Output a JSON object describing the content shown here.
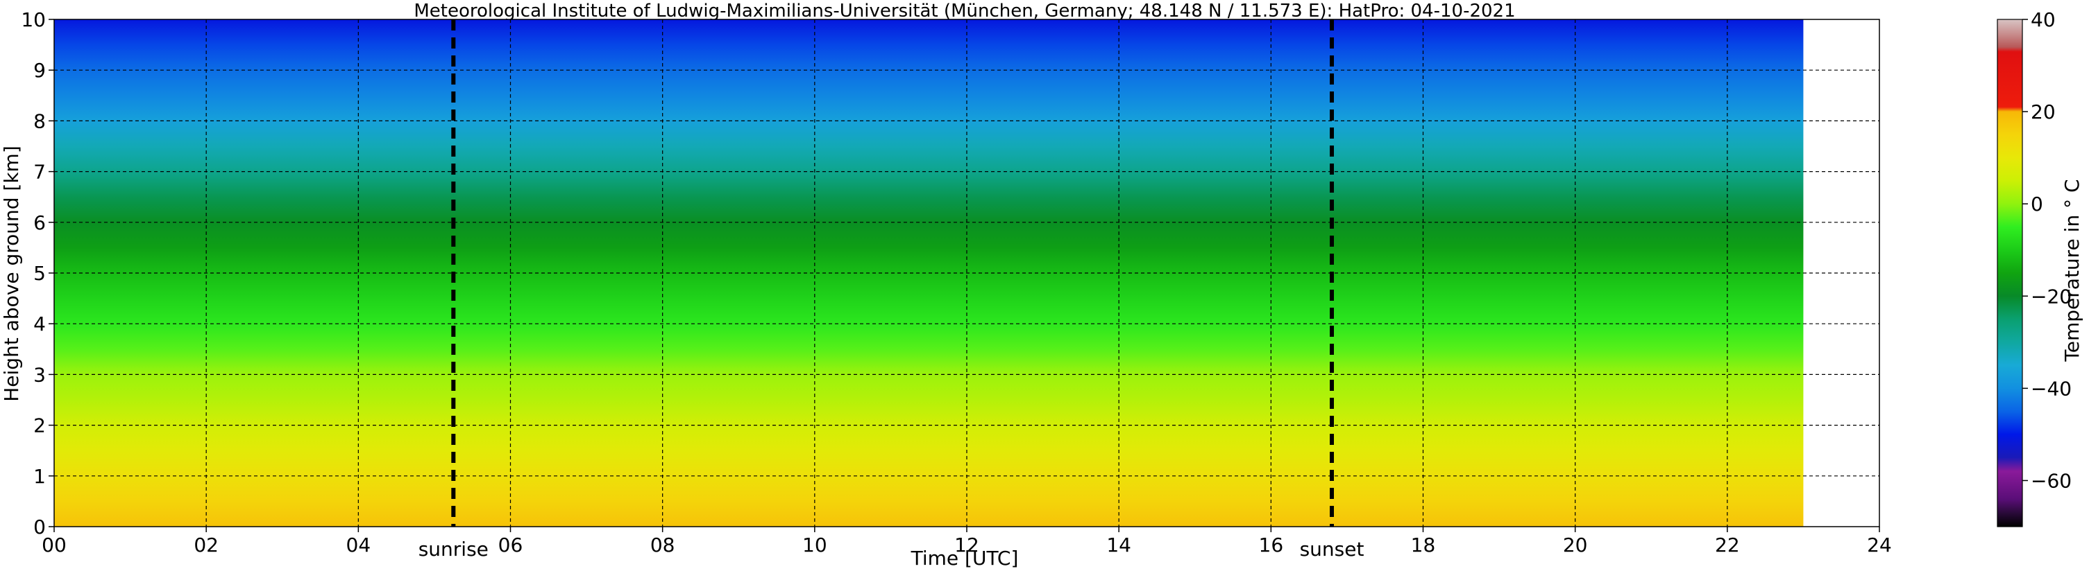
{
  "chart_data": {
    "type": "heatmap",
    "title": "Meteorological Institute of Ludwig-Maximilians-Universität (München, Germany; 48.148 N / 11.573 E):    HatPro: 04-10-2021",
    "xlabel": "Time [UTC]",
    "ylabel": "Height above ground [km]",
    "xlim": [
      0,
      24
    ],
    "ylim": [
      0,
      10
    ],
    "x_ticks": [
      "00",
      "02",
      "04",
      "06",
      "08",
      "10",
      "12",
      "14",
      "16",
      "18",
      "20",
      "22",
      "24"
    ],
    "y_ticks": [
      "0",
      "1",
      "2",
      "3",
      "4",
      "5",
      "6",
      "7",
      "8",
      "9",
      "10"
    ],
    "grid": true,
    "data_end_hour": 23.0,
    "annotations": [
      {
        "label": "sunrise",
        "x": 5.25
      },
      {
        "label": "sunset",
        "x": 16.8
      }
    ],
    "temperature_profile": {
      "height_km": [
        0.0,
        0.5,
        1.0,
        1.5,
        2.0,
        2.5,
        3.0,
        3.5,
        4.0,
        4.5,
        5.0,
        5.5,
        6.0,
        6.5,
        7.0,
        7.5,
        8.0,
        8.5,
        9.0,
        9.5,
        10.0
      ],
      "temperature_c": [
        18,
        15,
        12,
        9,
        6,
        3,
        1,
        -3,
        -6,
        -9,
        -12,
        -16,
        -19,
        -23,
        -28,
        -32,
        -37,
        -41,
        -44,
        -47,
        -51
      ]
    },
    "colorbar": {
      "label": "Temperature in ° C",
      "min": -70,
      "max": 40,
      "ticks": [
        "40",
        "20",
        "0",
        "−20",
        "−40",
        "−60"
      ],
      "tick_values": [
        40,
        20,
        0,
        -20,
        -40,
        -60
      ],
      "stops": [
        {
          "v": -70,
          "c": "#000000"
        },
        {
          "v": -67,
          "c": "#2a0a3a"
        },
        {
          "v": -64,
          "c": "#5a0e78"
        },
        {
          "v": -58,
          "c": "#8a1a9a"
        },
        {
          "v": -55,
          "c": "#1a1ab8"
        },
        {
          "v": -50,
          "c": "#0018e8"
        },
        {
          "v": -45,
          "c": "#0a64e6"
        },
        {
          "v": -40,
          "c": "#1290e0"
        },
        {
          "v": -35,
          "c": "#18aad6"
        },
        {
          "v": -30,
          "c": "#10a8a0"
        },
        {
          "v": -25,
          "c": "#0aa070"
        },
        {
          "v": -20,
          "c": "#088a28"
        },
        {
          "v": -15,
          "c": "#10a410"
        },
        {
          "v": -10,
          "c": "#1ccc18"
        },
        {
          "v": -5,
          "c": "#30ee20"
        },
        {
          "v": 0,
          "c": "#90f20e"
        },
        {
          "v": 5,
          "c": "#ccf005"
        },
        {
          "v": 10,
          "c": "#e8e808"
        },
        {
          "v": 15,
          "c": "#f4d40a"
        },
        {
          "v": 20,
          "c": "#f7b808"
        },
        {
          "v": 21,
          "c": "#ee1c0c"
        },
        {
          "v": 33,
          "c": "#e01010"
        },
        {
          "v": 34,
          "c": "#b85858"
        },
        {
          "v": 37,
          "c": "#c99090"
        },
        {
          "v": 40,
          "c": "#d8c4c4"
        }
      ]
    }
  }
}
